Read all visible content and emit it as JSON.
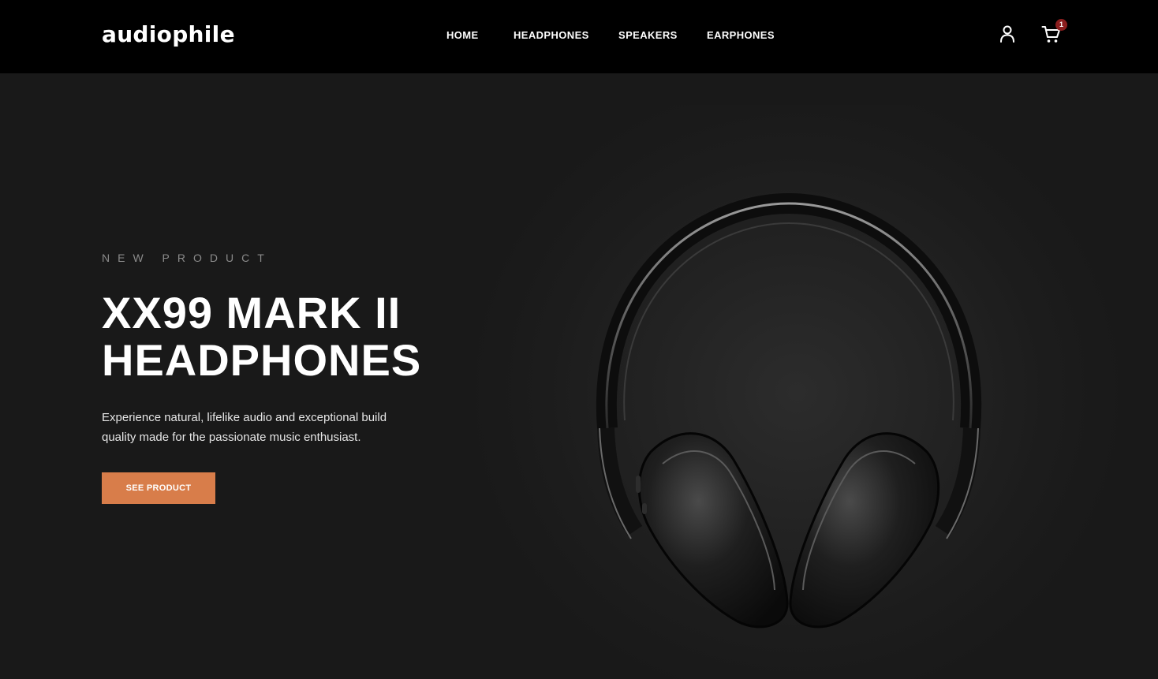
{
  "header": {
    "logo": "audiophile",
    "nav": [
      {
        "label": "HOME"
      },
      {
        "label": "HEADPHONES"
      },
      {
        "label": "SPEAKERS"
      },
      {
        "label": "EARPHONES"
      }
    ],
    "account_icon": "user-icon",
    "cart_icon": "cart-icon",
    "cart_count": "1"
  },
  "hero": {
    "overline": "NEW PRODUCT",
    "title_line1": "XX99 MARK II",
    "title_line2": "HEADPHONES",
    "description": "Experience natural, lifelike audio and exceptional build quality made for the passionate music enthusiast.",
    "cta_label": "SEE PRODUCT",
    "image_icon": "headphones-image"
  },
  "colors": {
    "accent": "#D87D4A",
    "badge": "#8B1E1E",
    "header_bg": "#000000",
    "hero_bg": "#191919"
  }
}
